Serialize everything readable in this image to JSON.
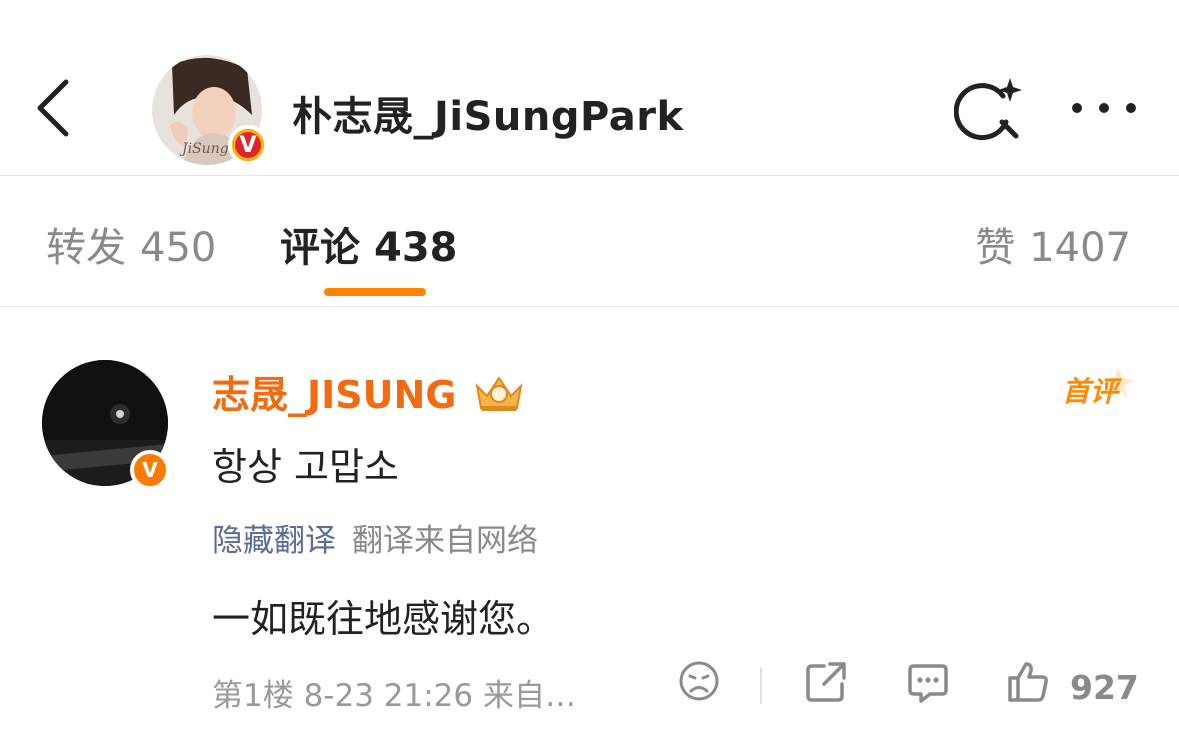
{
  "header": {
    "title": "朴志晟_JiSungPark",
    "avatar_label": "JiSung",
    "verified_badge": "V",
    "icons": {
      "back": "back-arrow-icon",
      "search": "super-search-icon",
      "more": "more-dots-icon"
    }
  },
  "tabs": {
    "repost": {
      "label": "转发",
      "count": "450"
    },
    "comments": {
      "label": "评论",
      "count": "438",
      "active": true
    },
    "likes": {
      "label": "赞",
      "count": "1407"
    },
    "accent_color": "#ff8200"
  },
  "comment": {
    "user_name": "志晟_JISUNG",
    "verified_badge": "V",
    "first_badge": "首评",
    "text": "항상 고맙소",
    "translation_toggle": "隐藏翻译",
    "translation_source": "翻译来自网络",
    "translation_text": "一如既往地感谢您。",
    "meta": "第1楼 8-23 21:26 来自…",
    "like_count": "927",
    "name_color": "#f36b10"
  }
}
